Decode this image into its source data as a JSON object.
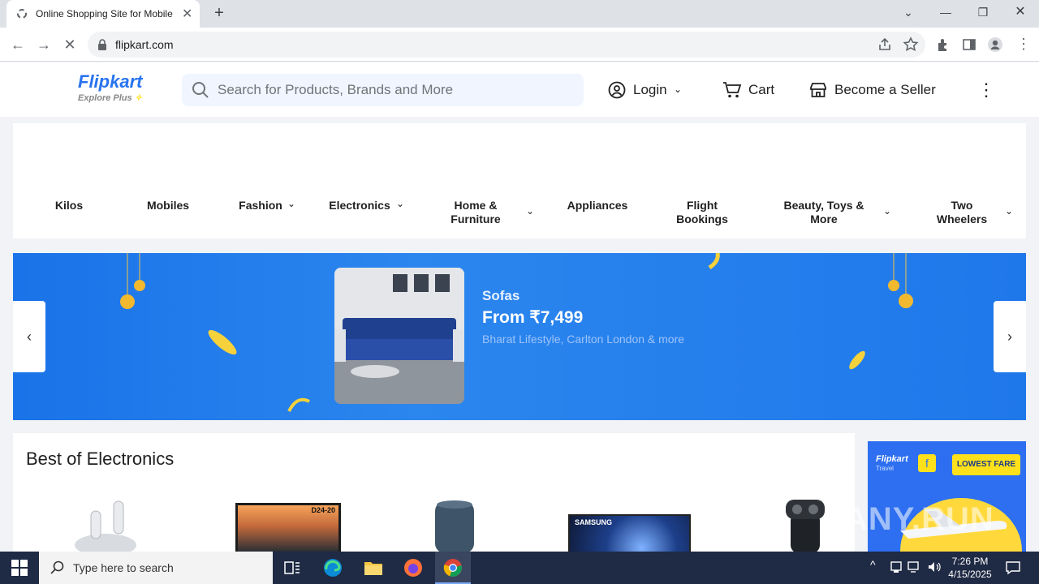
{
  "browser": {
    "tab_title": "Online Shopping Site for Mobile",
    "url": "flipkart.com"
  },
  "header": {
    "logo_name": "Flipkart",
    "logo_tagline": "Explore Plus",
    "search_placeholder": "Search for Products, Brands and More",
    "login_label": "Login",
    "cart_label": "Cart",
    "seller_label": "Become a Seller"
  },
  "categories": [
    {
      "label": "Kilos",
      "has_dropdown": false
    },
    {
      "label": "Mobiles",
      "has_dropdown": false
    },
    {
      "label": "Fashion",
      "has_dropdown": true
    },
    {
      "label": "Electronics",
      "has_dropdown": true
    },
    {
      "label": "Home & Furniture",
      "has_dropdown": true
    },
    {
      "label": "Appliances",
      "has_dropdown": false
    },
    {
      "label": "Flight Bookings",
      "has_dropdown": false
    },
    {
      "label": "Beauty, Toys & More",
      "has_dropdown": true
    },
    {
      "label": "Two Wheelers",
      "has_dropdown": true
    }
  ],
  "banner": {
    "title": "Sofas",
    "price": "From ₹7,499",
    "subtitle": "Bharat Lifestyle, Carlton London & more"
  },
  "section": {
    "title": "Best of Electronics",
    "tv_model": "D24-20",
    "tv_brand": "SAMSUNG"
  },
  "ad": {
    "brand": "Flipkart",
    "brand_sub": "Travel",
    "badge": "LOWEST FARE"
  },
  "watermark": "ANY.RUN",
  "taskbar": {
    "search_placeholder": "Type here to search",
    "time": "7:26 PM",
    "date": "4/15/2025"
  },
  "colors": {
    "brand_blue": "#2874f0",
    "banner_blue": "#1a73e8",
    "taskbar": "#1f2a44"
  }
}
